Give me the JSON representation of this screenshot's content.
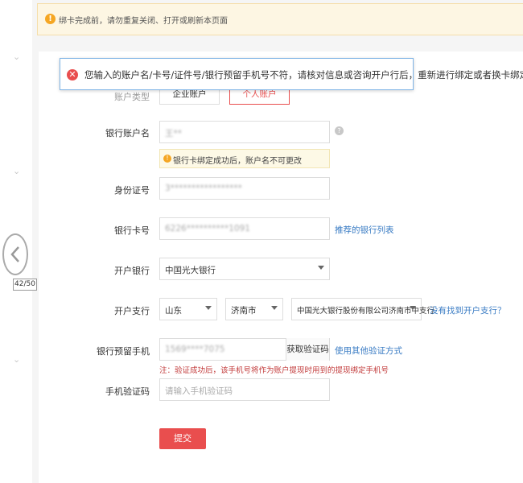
{
  "warning_bar": {
    "text": "绑卡完成前，请勿重复关闭、打开或刷新本页面"
  },
  "error_tip": {
    "text": "您输入的账户名/卡号/证件号/银行预留手机号不符，请核对信息或咨询开户行后，重新进行绑定或者换卡绑定"
  },
  "form": {
    "account_type": {
      "label": "账户类型",
      "corp": "企业账户",
      "personal": "个人账户"
    },
    "account_name": {
      "label": "银行账户名",
      "value": "王**",
      "hint": "银行卡绑定成功后，账户名不可更改"
    },
    "id_number": {
      "label": "身份证号",
      "value": "3*****************"
    },
    "card_number": {
      "label": "银行卡号",
      "value": "6226**********1091",
      "link": "推荐的银行列表"
    },
    "bank": {
      "label": "开户银行",
      "value": "中国光大银行"
    },
    "branch": {
      "label": "开户支行",
      "province": "山东",
      "city": "济南市",
      "branch_name": "中国光大银行股份有限公司济南市中支行",
      "link": "没有找到开户支行？"
    },
    "phone": {
      "label": "银行预留手机",
      "value": "1569****7075",
      "sms_button": "获取验证码",
      "link": "使用其他验证方式",
      "note": "注：验证成功后，该手机号将作为账户提现时用到的提现绑定手机号"
    },
    "sms_code": {
      "label": "手机验证码",
      "placeholder": "请输入手机验证码"
    },
    "submit": "提交"
  },
  "pager": {
    "text": "42/50"
  }
}
